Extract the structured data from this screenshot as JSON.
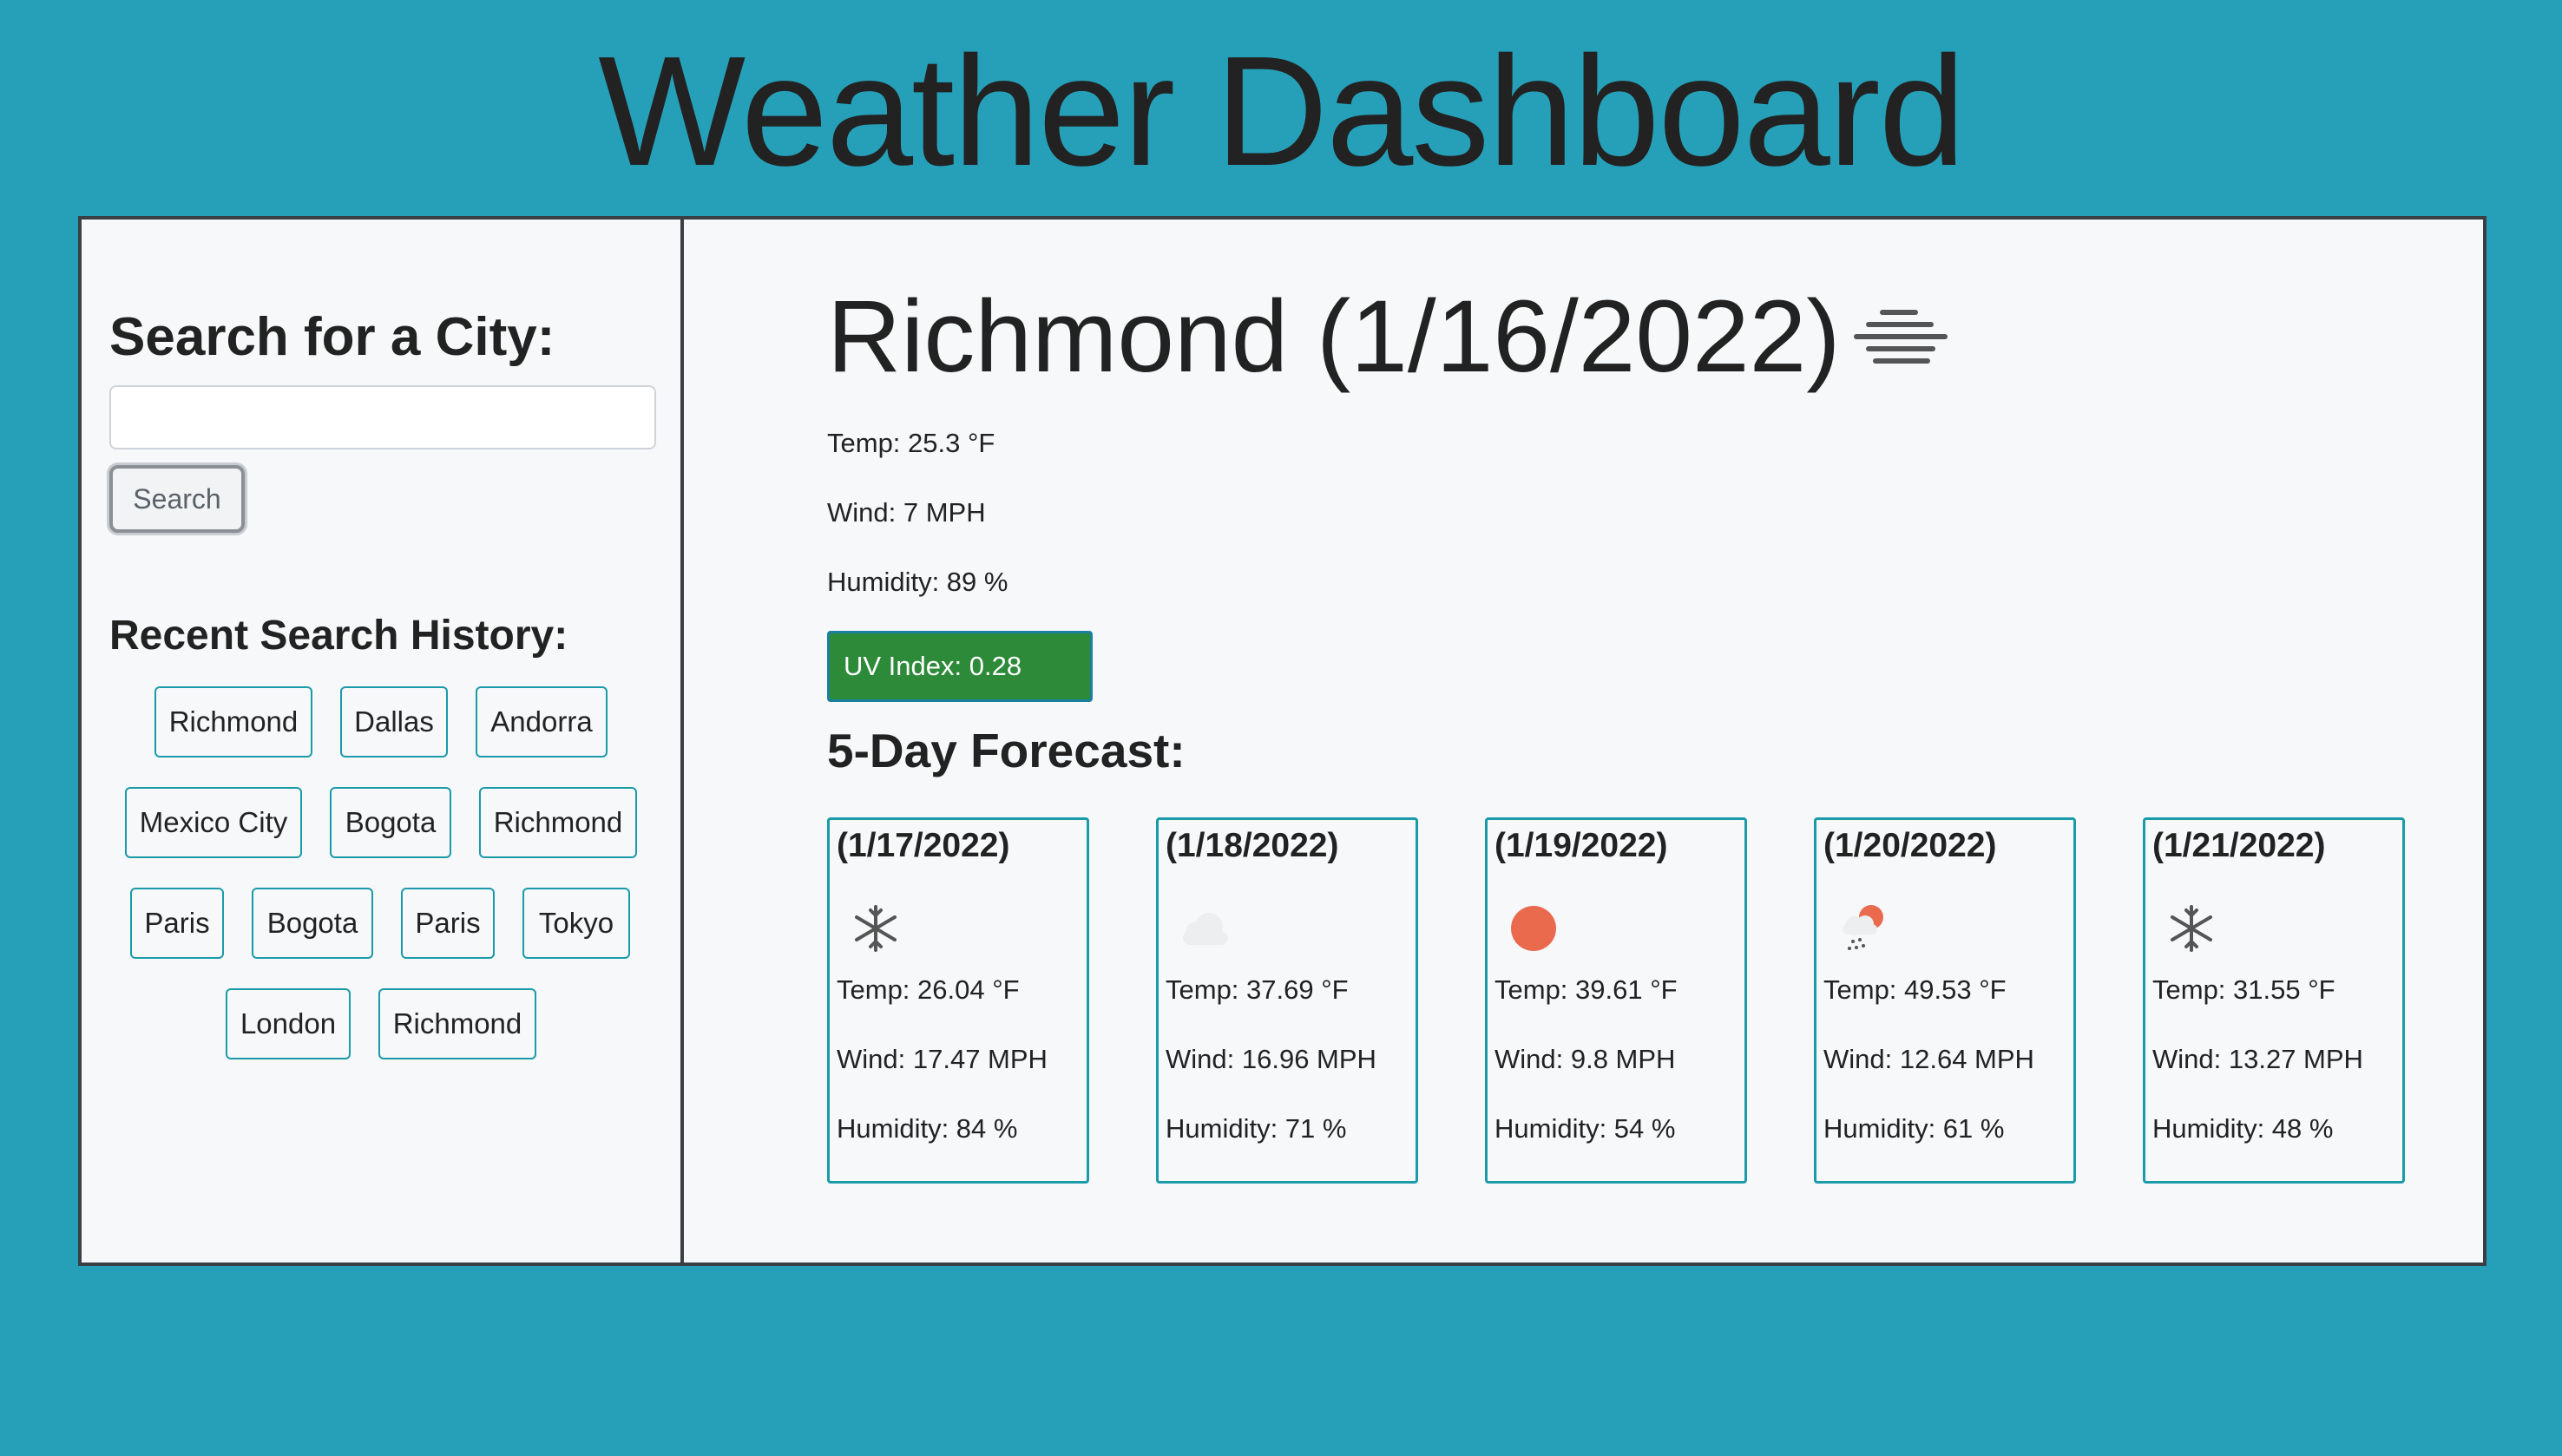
{
  "page": {
    "title": "Weather Dashboard",
    "background_color": "#26a0b8"
  },
  "sidebar": {
    "search_heading": "Search for a City:",
    "search_input_value": "",
    "search_button_label": "Search",
    "history_heading": "Recent Search History:",
    "history": [
      "Richmond",
      "Dallas",
      "Andorra",
      "Mexico City",
      "Bogota",
      "Richmond",
      "Paris",
      "Bogota",
      "Paris",
      "Tokyo",
      "London",
      "Richmond"
    ]
  },
  "current": {
    "heading": "Richmond (1/16/2022)",
    "icon": "fog-icon",
    "temp": "Temp: 25.3 °F",
    "wind": "Wind: 7 MPH",
    "humidity": "Humidity: 89 %",
    "uv": "UV Index: 0.28",
    "uv_color": "#2c8a38"
  },
  "forecast": {
    "heading": "5-Day Forecast:",
    "days": [
      {
        "date": "(1/17/2022)",
        "icon": "snow-icon",
        "temp": "Temp: 26.04 °F",
        "wind": "Wind: 17.47 MPH",
        "humidity": "Humidity: 84 %"
      },
      {
        "date": "(1/18/2022)",
        "icon": "cloud-icon",
        "temp": "Temp: 37.69 °F",
        "wind": "Wind: 16.96 MPH",
        "humidity": "Humidity: 71 %"
      },
      {
        "date": "(1/19/2022)",
        "icon": "sun-icon",
        "temp": "Temp: 39.61 °F",
        "wind": "Wind: 9.8 MPH",
        "humidity": "Humidity: 54 %"
      },
      {
        "date": "(1/20/2022)",
        "icon": "rain-sun-icon",
        "temp": "Temp: 49.53 °F",
        "wind": "Wind: 12.64 MPH",
        "humidity": "Humidity: 61 %"
      },
      {
        "date": "(1/21/2022)",
        "icon": "snow-icon",
        "temp": "Temp: 31.55 °F",
        "wind": "Wind: 13.27 MPH",
        "humidity": "Humidity: 48 %"
      }
    ]
  }
}
